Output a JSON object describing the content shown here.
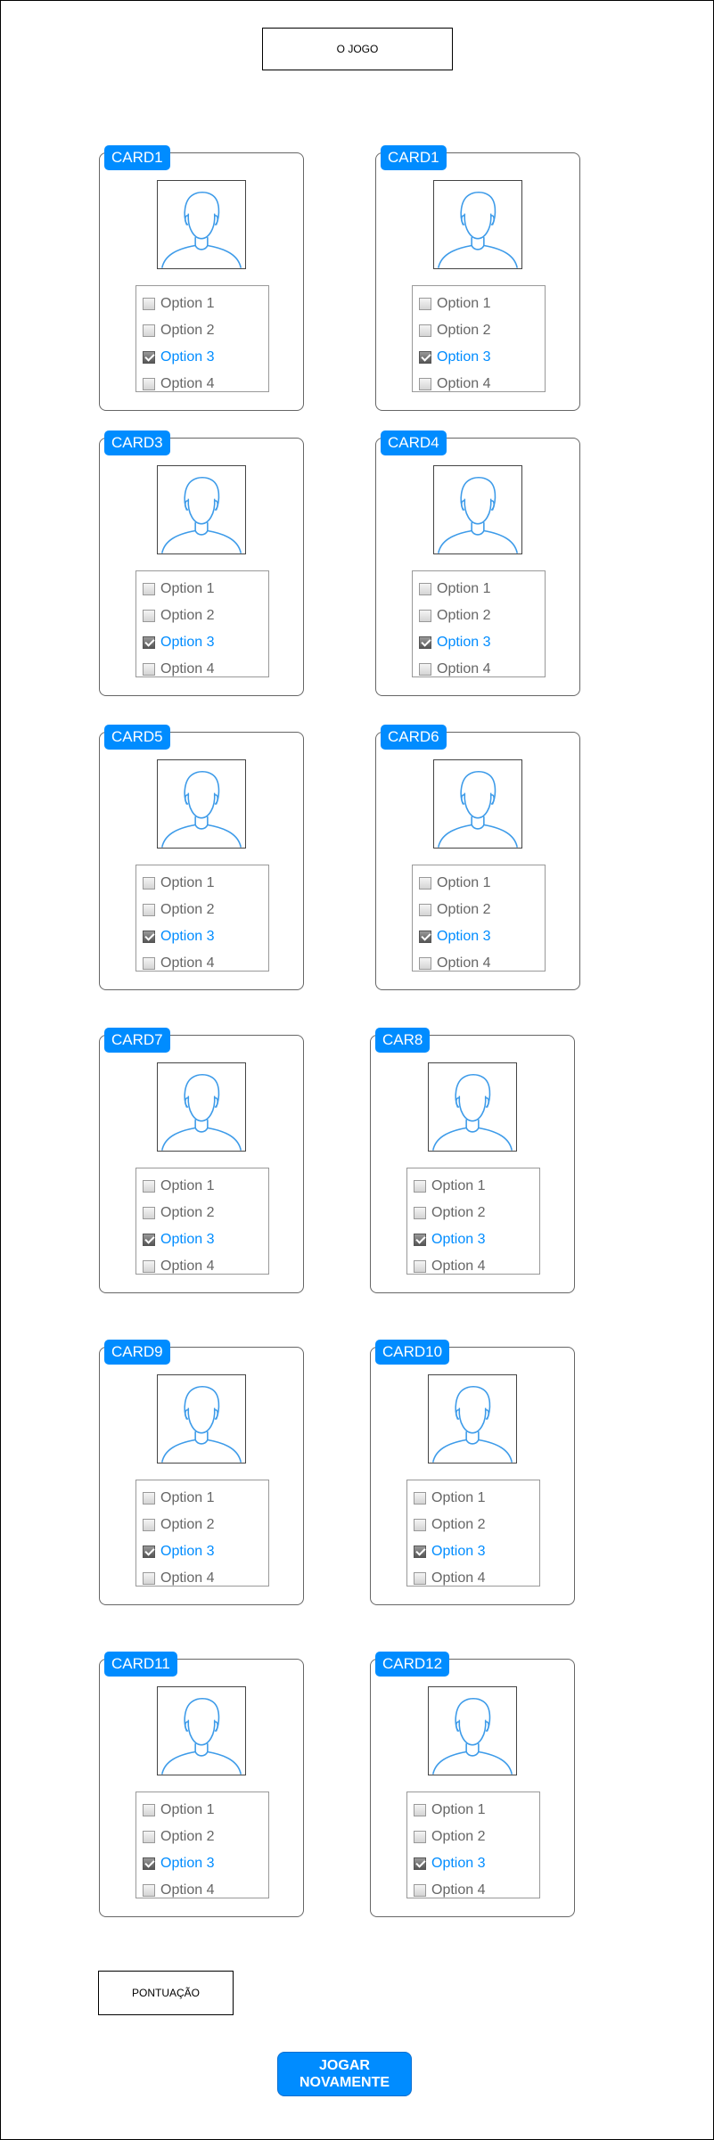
{
  "header": {
    "title": "O JOGO"
  },
  "cards": [
    {
      "title": "CARD1",
      "options": [
        "Option 1",
        "Option 2",
        "Option 3",
        "Option 4"
      ],
      "checked_index": 2
    },
    {
      "title": "CARD1",
      "options": [
        "Option 1",
        "Option 2",
        "Option 3",
        "Option 4"
      ],
      "checked_index": 2
    },
    {
      "title": "CARD3",
      "options": [
        "Option 1",
        "Option 2",
        "Option 3",
        "Option 4"
      ],
      "checked_index": 2
    },
    {
      "title": "CARD4",
      "options": [
        "Option 1",
        "Option 2",
        "Option 3",
        "Option 4"
      ],
      "checked_index": 2
    },
    {
      "title": "CARD5",
      "options": [
        "Option 1",
        "Option 2",
        "Option 3",
        "Option 4"
      ],
      "checked_index": 2
    },
    {
      "title": "CARD6",
      "options": [
        "Option 1",
        "Option 2",
        "Option 3",
        "Option 4"
      ],
      "checked_index": 2
    },
    {
      "title": "CARD7",
      "options": [
        "Option 1",
        "Option 2",
        "Option 3",
        "Option 4"
      ],
      "checked_index": 2
    },
    {
      "title": "CAR8",
      "options": [
        "Option 1",
        "Option 2",
        "Option 3",
        "Option 4"
      ],
      "checked_index": 2
    },
    {
      "title": "CARD9",
      "options": [
        "Option 1",
        "Option 2",
        "Option 3",
        "Option 4"
      ],
      "checked_index": 2
    },
    {
      "title": "CARD10",
      "options": [
        "Option 1",
        "Option 2",
        "Option 3",
        "Option 4"
      ],
      "checked_index": 2
    },
    {
      "title": "CARD11",
      "options": [
        "Option 1",
        "Option 2",
        "Option 3",
        "Option 4"
      ],
      "checked_index": 2
    },
    {
      "title": "CARD12",
      "options": [
        "Option 1",
        "Option 2",
        "Option 3",
        "Option 4"
      ],
      "checked_index": 2
    }
  ],
  "footer": {
    "score_label": "PONTUAÇÃO",
    "play_again_label": "JOGAR\nNOVAMENTE"
  },
  "colors": {
    "accent": "#008cff",
    "option_text": "#666666",
    "avatar_stroke": "#3d9be9"
  },
  "icons": {
    "avatar": "person-silhouette-icon",
    "checkbox": "checkbox-icon"
  }
}
